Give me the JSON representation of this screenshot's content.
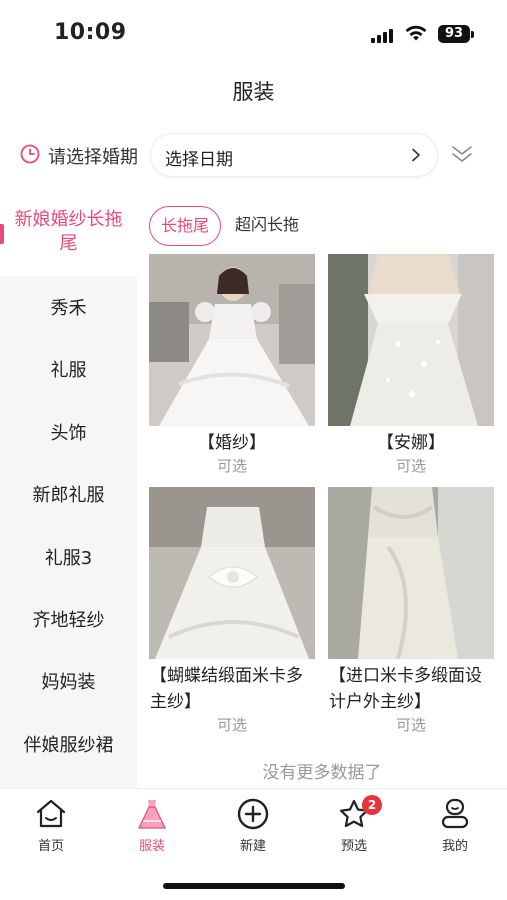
{
  "status_bar": {
    "time": "10:09",
    "battery": "93"
  },
  "header": {
    "title": "服装"
  },
  "date_selector": {
    "label": "请选择婚期",
    "placeholder": "选择日期"
  },
  "sidebar": {
    "items": [
      {
        "label": "新娘婚纱长拖尾",
        "active": true
      },
      {
        "label": "秀禾"
      },
      {
        "label": "礼服"
      },
      {
        "label": "头饰"
      },
      {
        "label": "新郎礼服"
      },
      {
        "label": "礼服3"
      },
      {
        "label": "齐地轻纱"
      },
      {
        "label": "妈妈装"
      },
      {
        "label": "伴娘服纱裙"
      }
    ]
  },
  "subtabs": [
    {
      "label": "长拖尾",
      "active": true
    },
    {
      "label": "超闪长拖"
    }
  ],
  "products": [
    {
      "name": "【婚纱】",
      "status": "可选"
    },
    {
      "name": "【安娜】",
      "status": "可选"
    },
    {
      "name": "【蝴蝶结缎面米卡多主纱】",
      "status": "可选"
    },
    {
      "name": "【进口米卡多缎面设计户外主纱】",
      "status": "可选"
    }
  ],
  "footer_note": "没有更多数据了",
  "tabbar": {
    "items": [
      {
        "label": "首页",
        "icon": "home-icon"
      },
      {
        "label": "服装",
        "icon": "dress-icon",
        "active": true
      },
      {
        "label": "新建",
        "icon": "plus-circle-icon"
      },
      {
        "label": "预选",
        "icon": "star-icon",
        "badge": "2"
      },
      {
        "label": "我的",
        "icon": "user-icon"
      }
    ]
  },
  "colors": {
    "accent": "#e94a7a",
    "badge": "#e8333a",
    "muted": "#999999"
  }
}
